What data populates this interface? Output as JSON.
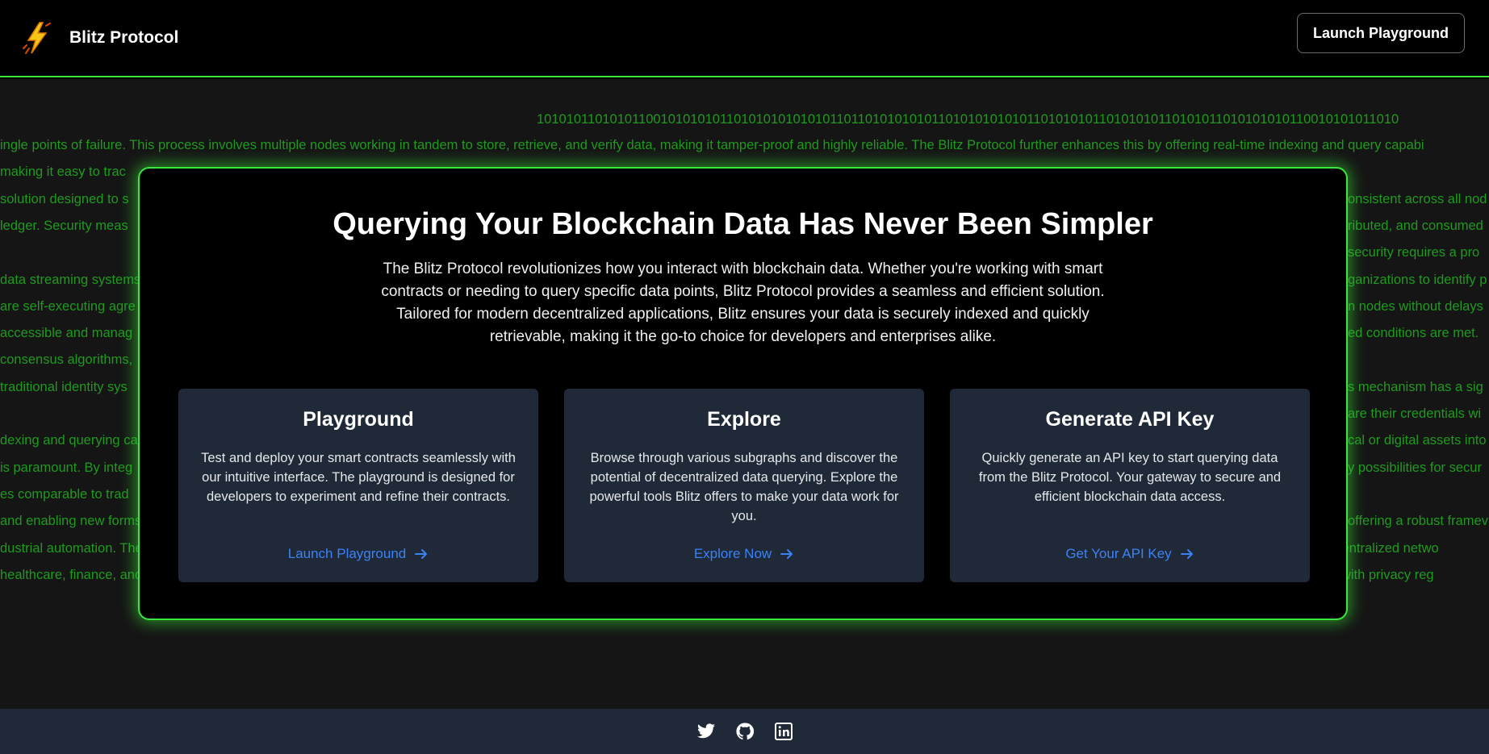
{
  "header": {
    "brand_name": "Blitz Protocol",
    "logo_icon": "lightning-bolt-icon",
    "launch_button": "Launch Playground"
  },
  "background": {
    "binary": "1010101101010110010101010110101010101010110110101010101101010101010110101010110101010110101011010101010110010101011010",
    "lines": [
      "ingle points of failure. This process involves multiple nodes working in tandem to store, retrieve, and verify data, making it tamper-proof and highly reliable. The Blitz Protocol further enhances this by offering real-time indexing and query capabi",
      " making it easy to trac",
      "solution designed to s",
      "ledger. Security meas",
      "",
      "data streaming systems",
      "are self-executing agre",
      "accessible and manag",
      "consensus algorithms,",
      "traditional identity sys",
      "",
      "dexing and querying ca",
      "is paramount. By integ",
      "es comparable to trad",
      "and enabling new forms of investment and commerce.",
      "dustrial automation. The Blitz Protocol enhances IoT networks by providing real-time data indexing and querying capabilities, ensuring that data generated by IoT devices is efficiently stored, processed, and accessible across decentralized netwo",
      "healthcare, finance, and legal services, where data privacy is paramount. By integrating advanced encryption techniques and access controls, the Blitz Protocol helps organizations protect their data while maintaining compliance with privacy reg"
    ],
    "right_lines": [
      "",
      "",
      "onsistent across all nod",
      "ributed, and consumed",
      "security requires a pro",
      "ganizations to identify p",
      "n nodes without delays",
      "ed conditions are met.",
      "",
      "s mechanism has a sig",
      "are their credentials wi",
      "cal or digital assets into",
      "y possibilities for secur",
      "",
      "offering a robust framev"
    ]
  },
  "hero": {
    "title": "Querying Your Blockchain Data Has Never Been Simpler",
    "description": "The Blitz Protocol revolutionizes how you interact with blockchain data. Whether you're working with smart contracts or needing to query specific data points, Blitz Protocol provides a seamless and efficient solution. Tailored for modern decentralized applications, Blitz ensures your data is securely indexed and quickly retrievable, making it the go-to choice for developers and enterprises alike."
  },
  "features": [
    {
      "title": "Playground",
      "text": "Test and deploy your smart contracts seamlessly with our intuitive interface. The playground is designed for developers to experiment and refine their contracts.",
      "link": "Launch Playground"
    },
    {
      "title": "Explore",
      "text": "Browse through various subgraphs and discover the potential of decentralized data querying. Explore the powerful tools Blitz offers to make your data work for you.",
      "link": "Explore Now"
    },
    {
      "title": "Generate API Key",
      "text": "Quickly generate an API key to start querying data from the Blitz Protocol. Your gateway to secure and efficient blockchain data access.",
      "link": "Get Your API Key"
    }
  ],
  "footer": {
    "icons": [
      "twitter-icon",
      "github-icon",
      "linkedin-icon"
    ]
  },
  "colors": {
    "accent_green": "#39e639",
    "link_blue": "#3b82f6",
    "card_bg": "#1f2937"
  }
}
